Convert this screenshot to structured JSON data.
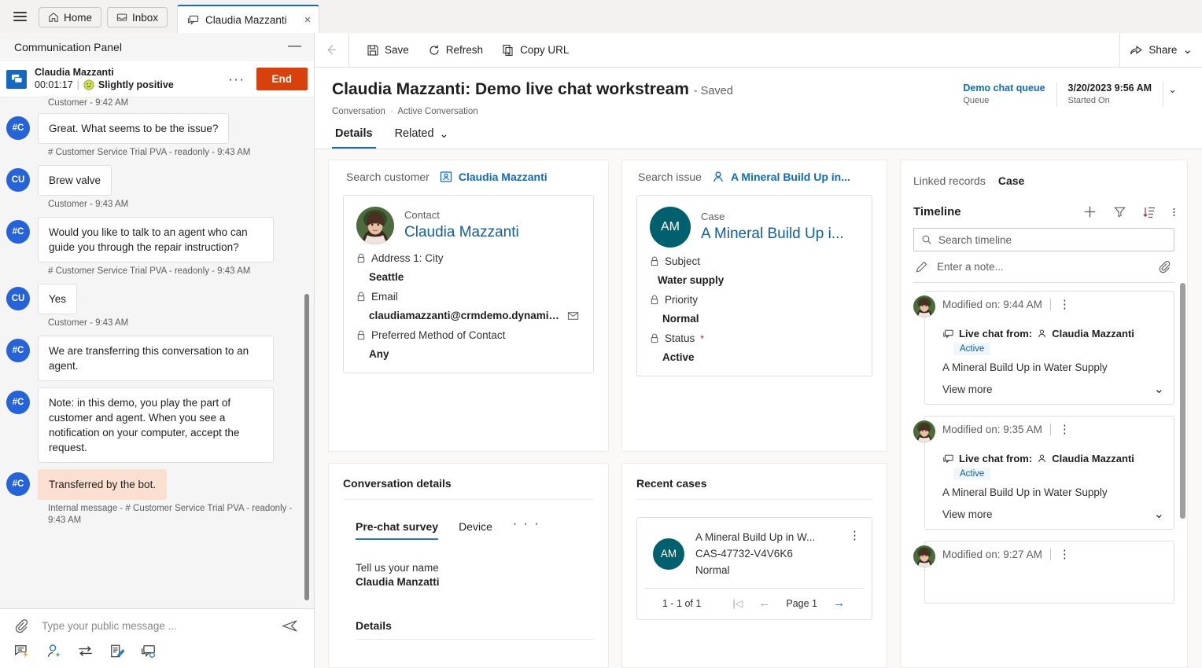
{
  "tabstrip": {
    "menu_icon": "hamburger-icon",
    "tabs": [
      {
        "label": "Home",
        "icon": "home-icon"
      },
      {
        "label": "Inbox",
        "icon": "inbox-icon"
      }
    ],
    "active_tab": {
      "label": "Claudia Mazzanti",
      "icon": "chat-icon",
      "close": "×"
    }
  },
  "comm_panel": {
    "title": "Communication Panel",
    "minimize": "—",
    "conversation": {
      "name": "Claudia Mazzanti",
      "timer": "00:01:17",
      "divider": "|",
      "sentiment": "Slightly positive",
      "more_label": "···",
      "end_label": "End"
    },
    "messages": [
      {
        "kind": "time-header",
        "text": "Customer - 9:42 AM"
      },
      {
        "kind": "msg",
        "avatar": "#C",
        "text": "Great. What seems to be the issue?",
        "foot": "# Customer Service Trial PVA - readonly - 9:43 AM",
        "internal": false
      },
      {
        "kind": "msg",
        "avatar": "CU",
        "text": "Brew valve",
        "foot": "Customer - 9:43 AM",
        "internal": false
      },
      {
        "kind": "msg",
        "avatar": "#C",
        "text": "Would you like to talk to an agent who can guide you through the repair instruction?",
        "foot": "# Customer Service Trial PVA - readonly - 9:43 AM",
        "internal": false
      },
      {
        "kind": "msg",
        "avatar": "CU",
        "text": "Yes",
        "foot": "Customer - 9:43 AM",
        "internal": false
      },
      {
        "kind": "msg",
        "avatar": "#C",
        "text": "We are transferring this conversation to an agent.",
        "foot": "",
        "internal": false
      },
      {
        "kind": "msg",
        "avatar": "#C",
        "text": "Note: in this demo, you play the part of customer and agent. When you see a notification on your computer, accept the request.",
        "foot": "",
        "internal": false
      },
      {
        "kind": "msg",
        "avatar": "#C",
        "text": "Transferred by the bot.",
        "foot": "Internal message - # Customer Service Trial PVA - readonly - 9:43 AM",
        "internal": true
      }
    ],
    "composer": {
      "attach_icon": "paperclip-icon",
      "placeholder": "Type your public message ...",
      "value": "",
      "send_icon": "send-icon",
      "tools": [
        "quick-reply-icon",
        "add-agent-icon",
        "transfer-icon",
        "notes-icon",
        "linked-conversation-icon"
      ]
    }
  },
  "command_bar": {
    "back_icon": "back-arrow-icon",
    "buttons": [
      {
        "label": "Save",
        "icon": "save-icon"
      },
      {
        "label": "Refresh",
        "icon": "refresh-icon"
      },
      {
        "label": "Copy URL",
        "icon": "copy-url-icon"
      }
    ],
    "share": {
      "label": "Share",
      "icon": "share-icon",
      "chevron": "⌄"
    }
  },
  "record_header": {
    "title": "Claudia Mazzanti: Demo live chat workstream",
    "saved_state": "- Saved",
    "breadcrumb_entity": "Conversation",
    "breadcrumb_sep": "·",
    "breadcrumb_form": "Active Conversation",
    "fields": [
      {
        "value": "Demo chat queue",
        "label": "Queue",
        "link": true
      },
      {
        "value": "3/20/2023 9:56 AM",
        "label": "Started On",
        "link": false
      }
    ],
    "expand_chevron": "⌄"
  },
  "form_tabs": [
    {
      "label": "Details",
      "active": true,
      "chevron": ""
    },
    {
      "label": "Related",
      "active": false,
      "chevron": "⌄"
    }
  ],
  "customer_card": {
    "search_label": "Search customer",
    "search_value": "Claudia Mazzanti",
    "search_icon": "contact-card-icon",
    "entity_kind": "Contact",
    "entity_name": "Claudia Mazzanti",
    "avatar_icon": "contact-photo",
    "fields": [
      {
        "label": "Address 1: City",
        "value": "Seattle",
        "lock": "lock-icon",
        "required": false,
        "trailing_icon": ""
      },
      {
        "label": "Email",
        "value": "claudiamazzanti@crmdemo.dynamics....",
        "lock": "lock-icon",
        "required": false,
        "trailing_icon": "email-icon"
      },
      {
        "label": "Preferred Method of Contact",
        "value": "Any",
        "lock": "lock-icon",
        "required": false,
        "trailing_icon": ""
      }
    ]
  },
  "case_card": {
    "search_label": "Search issue",
    "search_value": "A Mineral Build Up in...",
    "search_icon": "person-icon",
    "entity_kind": "Case",
    "entity_name": "A Mineral Build Up i...",
    "avatar_initials": "AM",
    "fields": [
      {
        "label": "Subject",
        "value": "Water supply",
        "lock": "lock-icon",
        "required": false,
        "trailing_icon": ""
      },
      {
        "label": "Priority",
        "value": "Normal",
        "lock": "lock-icon",
        "required": false,
        "trailing_icon": ""
      },
      {
        "label": "Status",
        "value": "Active",
        "lock": "lock-icon",
        "required": true,
        "trailing_icon": ""
      }
    ]
  },
  "conversation_details": {
    "title": "Conversation details",
    "tabs": [
      {
        "label": "Pre-chat survey",
        "active": true
      },
      {
        "label": "Device",
        "active": false
      },
      {
        "label": "· · ·",
        "active": false
      }
    ],
    "question": "Tell us your name",
    "answer": "Claudia Manzatti",
    "details_heading": "Details"
  },
  "recent_cases": {
    "title": "Recent cases",
    "items": [
      {
        "initials": "AM",
        "title": "A Mineral Build Up in W...",
        "number": "CAS-47732-V4V6K6",
        "priority": "Normal",
        "kebab": "⋮"
      }
    ],
    "pager": {
      "count": "1 - 1 of 1",
      "first": "|◁",
      "prev": "←",
      "page": "Page 1",
      "next": "→"
    }
  },
  "timeline": {
    "linked_records_label": "Linked records",
    "linked_records_selected": "Case",
    "title": "Timeline",
    "actions": [
      "add-icon",
      "filter-icon",
      "sort-icon",
      "more-icon"
    ],
    "search_placeholder": "Search timeline",
    "search_value": "",
    "search_icon": "search-icon",
    "note_placeholder": "Enter a note...",
    "note_icon": "pencil-icon",
    "note_attach_icon": "paperclip-icon",
    "items": [
      {
        "modified": "Modified on: 9:44 AM",
        "kebab": "⋮",
        "channel_icon": "chat-icon",
        "header": "Live chat from:",
        "person_icon": "person-icon",
        "person": "Claudia Mazzanti",
        "status": "Active",
        "description": "A Mineral Build Up in Water Supply",
        "view_more": "View more",
        "chevron": "⌄"
      },
      {
        "modified": "Modified on: 9:35 AM",
        "kebab": "⋮",
        "channel_icon": "chat-icon",
        "header": "Live chat from:",
        "person_icon": "person-icon",
        "person": "Claudia Mazzanti",
        "status": "Active",
        "description": "A Mineral Build Up in Water Supply",
        "view_more": "View more",
        "chevron": "⌄"
      },
      {
        "modified": "Modified on: 9:27 AM",
        "kebab": "⋮",
        "channel_icon": "chat-icon",
        "header": "",
        "person_icon": "person-icon",
        "person": "",
        "status": "",
        "description": "",
        "view_more": "",
        "chevron": ""
      }
    ]
  },
  "colors": {
    "accent": "#0f6cbd",
    "end_button": "#d8400c",
    "avatar_blue": "#2663d8",
    "case_teal": "#00606e",
    "internal_msg": "#fbdfd0",
    "link": "#115ea3"
  }
}
